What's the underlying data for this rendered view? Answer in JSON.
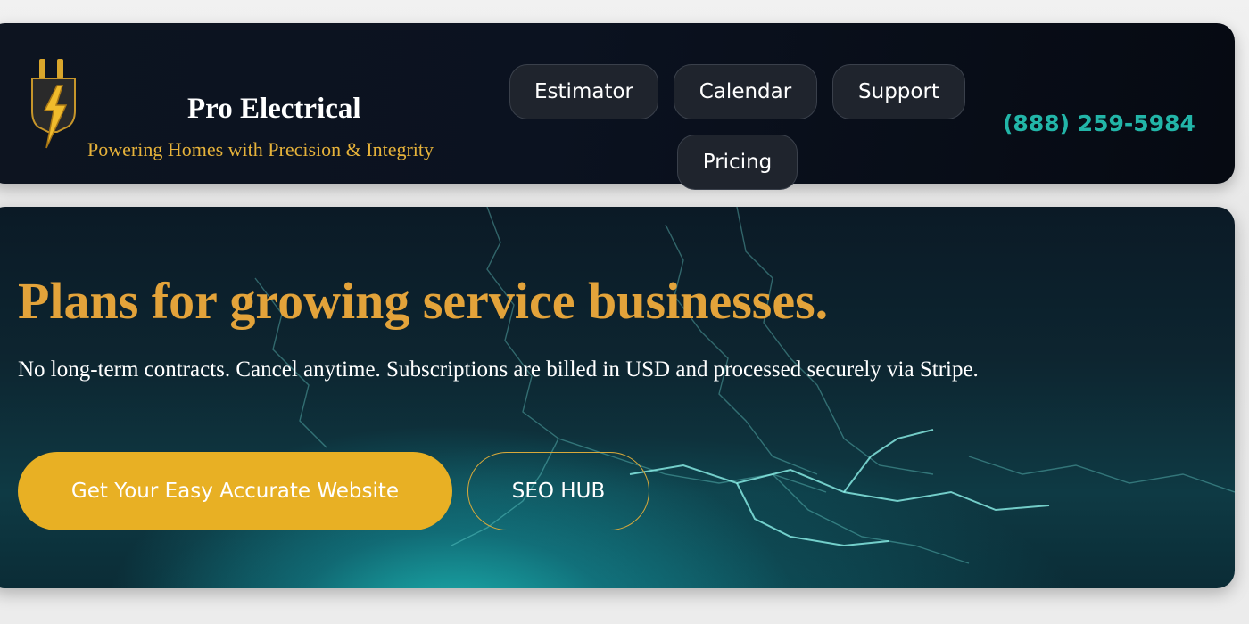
{
  "header": {
    "logo_icon": "electric-plug-bolt-icon",
    "brand_title": "Pro Electrical",
    "tagline": "Powering Homes with Precision & Integrity",
    "nav": [
      {
        "label": "Estimator"
      },
      {
        "label": "Calendar"
      },
      {
        "label": "Support"
      },
      {
        "label": "Pricing"
      }
    ],
    "phone": "(888) 259-5984"
  },
  "hero": {
    "title": "Plans for growing service businesses.",
    "subtitle": "No long-term contracts. Cancel anytime. Subscriptions are billed in USD and processed securely via Stripe.",
    "primary_cta": "Get Your Easy Accurate Website",
    "secondary_cta": "SEO HUB",
    "background": "lightning-storm"
  },
  "colors": {
    "header_bg": "#0b1220",
    "nav_button_bg": "#1f242d",
    "phone": "#22b5a8",
    "tagline": "#e6b23a",
    "hero_title": "#e3a33a",
    "primary_cta_bg": "#e8b024",
    "secondary_cta_border": "#d8a93a",
    "hero_glow": "#1ec8c3"
  }
}
